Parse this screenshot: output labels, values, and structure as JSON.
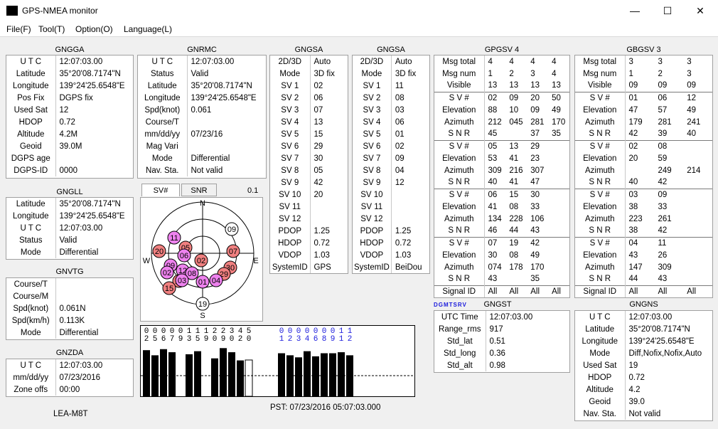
{
  "window": {
    "title": "GPS-NMEA monitor",
    "minimize": "—",
    "maximize": "☐",
    "close": "✕"
  },
  "menu": [
    "File(F)",
    "Tool(T)",
    "Option(O)",
    "Language(L)"
  ],
  "gngga": {
    "title": "GNGGA",
    "rows": [
      [
        "U T C",
        "12:07:03.00"
      ],
      [
        "Latitude",
        " 35°20'08.7174\"N"
      ],
      [
        "Longitude",
        "139°24'25.6548\"E"
      ],
      [
        "Pos Fix",
        "DGPS fix"
      ],
      [
        "Used Sat",
        "12"
      ],
      [
        "HDOP",
        "0.72"
      ],
      [
        "Altitude",
        "4.2M"
      ],
      [
        "Geoid",
        "39.0M"
      ],
      [
        "DGPS age",
        ""
      ],
      [
        "DGPS-ID",
        "0000"
      ]
    ]
  },
  "gnrmc": {
    "title": "GNRMC",
    "rows": [
      [
        "U T C",
        "12:07:03.00"
      ],
      [
        "Status",
        "Valid"
      ],
      [
        "Latitude",
        " 35°20'08.7174\"N"
      ],
      [
        "Longitude",
        "139°24'25.6548\"E"
      ],
      [
        "Spd(knot)",
        "0.061"
      ],
      [
        "Course/T",
        ""
      ],
      [
        "mm/dd/yy",
        "07/23/16"
      ],
      [
        "Mag Vari",
        ""
      ],
      [
        "Mode",
        "Differential"
      ],
      [
        "Nav. Sta.",
        "Not valid"
      ]
    ]
  },
  "gngll": {
    "title": "GNGLL",
    "rows": [
      [
        "Latitude",
        " 35°20'08.7174\"N"
      ],
      [
        "Longitude",
        "139°24'25.6548\"E"
      ],
      [
        "U T C",
        "12:07:03.00"
      ],
      [
        "Status",
        "Valid"
      ],
      [
        "Mode",
        "Differential"
      ]
    ]
  },
  "gnvtg": {
    "title": "GNVTG",
    "rows": [
      [
        "Course/T",
        ""
      ],
      [
        "Course/M",
        ""
      ],
      [
        "Spd(knot)",
        "0.061N"
      ],
      [
        "Spd(km/h)",
        "0.113K"
      ],
      [
        "Mode",
        "Differential"
      ]
    ]
  },
  "gnzda": {
    "title": "GNZDA",
    "rows": [
      [
        "U T C",
        "12:07:03.00"
      ],
      [
        "mm/dd/yy",
        "07/23/2016"
      ],
      [
        "Zone offs",
        "00:00"
      ]
    ]
  },
  "gnsa1": {
    "title": "GNGSA",
    "rows": [
      [
        "2D/3D",
        "Auto"
      ],
      [
        "Mode",
        "3D fix"
      ],
      [
        "SV 1",
        "02"
      ],
      [
        "SV 2",
        "06"
      ],
      [
        "SV 3",
        "07"
      ],
      [
        "SV 4",
        "13"
      ],
      [
        "SV 5",
        "15"
      ],
      [
        "SV 6",
        "29"
      ],
      [
        "SV 7",
        "30"
      ],
      [
        "SV 8",
        "05"
      ],
      [
        "SV 9",
        "42"
      ],
      [
        "SV 10",
        "20"
      ],
      [
        "SV 11",
        ""
      ],
      [
        "SV 12",
        ""
      ],
      [
        "PDOP",
        "1.25"
      ],
      [
        "HDOP",
        "0.72"
      ],
      [
        "VDOP",
        "1.03"
      ],
      [
        "SystemID",
        "GPS"
      ]
    ]
  },
  "gnsa2": {
    "title": "GNGSA",
    "rows": [
      [
        "2D/3D",
        "Auto"
      ],
      [
        "Mode",
        "3D fix"
      ],
      [
        "SV 1",
        "11"
      ],
      [
        "SV 2",
        "08"
      ],
      [
        "SV 3",
        "03"
      ],
      [
        "SV 4",
        "06"
      ],
      [
        "SV 5",
        "01"
      ],
      [
        "SV 6",
        "02"
      ],
      [
        "SV 7",
        "09"
      ],
      [
        "SV 8",
        "04"
      ],
      [
        "SV 9",
        "12"
      ],
      [
        "SV 10",
        ""
      ],
      [
        "SV 11",
        ""
      ],
      [
        "SV 12",
        ""
      ],
      [
        "PDOP",
        "1.25"
      ],
      [
        "HDOP",
        "0.72"
      ],
      [
        "VDOP",
        "1.03"
      ],
      [
        "SystemID",
        "BeiDou"
      ]
    ]
  },
  "gpgsv": {
    "title": "GPGSV 4",
    "rows": [
      [
        "Msg total",
        "4",
        "4",
        "4",
        "4"
      ],
      [
        "Msg num",
        "1",
        "2",
        "3",
        "4"
      ],
      [
        "Visible",
        "13",
        "13",
        "13",
        "13"
      ],
      [
        "S V #",
        "02",
        "09",
        "20",
        "50"
      ],
      [
        "Elevation",
        "88",
        "10",
        "09",
        "49"
      ],
      [
        "Azimuth",
        "212",
        "045",
        "281",
        "170"
      ],
      [
        "S N R",
        "45",
        "",
        "37",
        "35"
      ],
      [
        "S V #",
        "05",
        "13",
        "29",
        ""
      ],
      [
        "Elevation",
        "53",
        "41",
        "23",
        ""
      ],
      [
        "Azimuth",
        "309",
        "216",
        "307",
        ""
      ],
      [
        "S N R",
        "40",
        "41",
        "47",
        ""
      ],
      [
        "S V #",
        "06",
        "15",
        "30",
        ""
      ],
      [
        "Elevation",
        "41",
        "08",
        "33",
        ""
      ],
      [
        "Azimuth",
        "134",
        "228",
        "106",
        ""
      ],
      [
        "S N R",
        "46",
        "44",
        "43",
        ""
      ],
      [
        "S V #",
        "07",
        "19",
        "42",
        ""
      ],
      [
        "Elevation",
        "30",
        "08",
        "49",
        ""
      ],
      [
        "Azimuth",
        "074",
        "178",
        "170",
        ""
      ],
      [
        "S N R",
        "43",
        "",
        "35",
        ""
      ],
      [
        "Signal ID",
        "All",
        "All",
        "All",
        "All"
      ]
    ]
  },
  "gbgsv": {
    "title": "GBGSV 3",
    "rows": [
      [
        "Msg total",
        "3",
        "3",
        "3"
      ],
      [
        "Msg num",
        "1",
        "2",
        "3"
      ],
      [
        "Visible",
        "09",
        "09",
        "09"
      ],
      [
        "S V #",
        "01",
        "06",
        "12"
      ],
      [
        "Elevation",
        "47",
        "57",
        "49"
      ],
      [
        "Azimuth",
        "179",
        "281",
        "241"
      ],
      [
        "S N R",
        "42",
        "39",
        "40"
      ],
      [
        "S V #",
        "02",
        "08",
        ""
      ],
      [
        "Elevation",
        "20",
        "59",
        ""
      ],
      [
        "Azimuth",
        "",
        "249",
        "214"
      ],
      [
        "S N R",
        "40",
        "42",
        ""
      ],
      [
        "S V #",
        "03",
        "09",
        ""
      ],
      [
        "Elevation",
        "38",
        "33",
        ""
      ],
      [
        "Azimuth",
        "223",
        "261",
        ""
      ],
      [
        "S N R",
        "38",
        "42",
        ""
      ],
      [
        "S V #",
        "04",
        "11",
        ""
      ],
      [
        "Elevation",
        "43",
        "26",
        ""
      ],
      [
        "Azimuth",
        "147",
        "309",
        ""
      ],
      [
        "S N R",
        "44",
        "43",
        ""
      ],
      [
        "Signal ID",
        "All",
        "All",
        "All"
      ]
    ]
  },
  "gngst": {
    "title": "GNGST",
    "flags": "DGMTSRV",
    "rows": [
      [
        "UTC Time",
        "12:07:03.00"
      ],
      [
        "Range_rms",
        "917"
      ],
      [
        "Std_lat",
        "0.51"
      ],
      [
        "Std_long",
        "0.36"
      ],
      [
        "Std_alt",
        "0.98"
      ]
    ]
  },
  "gngns": {
    "title": "GNGNS",
    "rows": [
      [
        "U T C",
        "12:07:03.00"
      ],
      [
        "Latitude",
        " 35°20'08.7174\"N"
      ],
      [
        "Longitude",
        "139°24'25.6548\"E"
      ],
      [
        "Mode",
        "Diff,Nofix,Nofix,Auto"
      ],
      [
        "Used Sat",
        "19"
      ],
      [
        "HDOP",
        "0.72"
      ],
      [
        "Altitude",
        "4.2"
      ],
      [
        "Geoid",
        "39.0"
      ],
      [
        "Nav. Sta.",
        "Not valid"
      ]
    ]
  },
  "sky": {
    "tab_sv": "SV#",
    "tab_snr": "SNR",
    "version": "0.1",
    "n": "N",
    "s": "S",
    "e": "E",
    "w": "W",
    "sats": [
      {
        "id": "11",
        "cls": "bd"
      },
      {
        "id": "09",
        "cls": "none"
      },
      {
        "id": "05",
        "cls": "gps"
      },
      {
        "id": "20",
        "cls": "gps"
      },
      {
        "id": "06",
        "cls": "bd"
      },
      {
        "id": "02",
        "cls": "gps"
      },
      {
        "id": "07",
        "cls": "gps"
      },
      {
        "id": "09",
        "cls": "bd"
      },
      {
        "id": "02",
        "cls": "bd"
      },
      {
        "id": "12",
        "cls": "bd"
      },
      {
        "id": "08",
        "cls": "bd"
      },
      {
        "id": "13",
        "cls": "gps"
      },
      {
        "id": "03",
        "cls": "bd"
      },
      {
        "id": "30",
        "cls": "gps"
      },
      {
        "id": "29",
        "cls": "gps"
      },
      {
        "id": "01",
        "cls": "bd"
      },
      {
        "id": "04",
        "cls": "bd"
      },
      {
        "id": "15",
        "cls": "gps"
      },
      {
        "id": "19",
        "cls": "none"
      }
    ]
  },
  "snr_chart": {
    "gps_labels": [
      "02",
      "05",
      "06",
      "07",
      "09",
      "13",
      "15",
      "19",
      "20",
      "29",
      "30",
      "42",
      "50"
    ],
    "gps_values": [
      45,
      40,
      46,
      43,
      0,
      41,
      44,
      0,
      37,
      47,
      43,
      35,
      0
    ],
    "bd_labels": [
      "01",
      "02",
      "03",
      "04",
      "06",
      "08",
      "09",
      "11",
      "12"
    ],
    "bd_values": [
      42,
      40,
      38,
      44,
      39,
      42,
      42,
      43,
      40
    ]
  },
  "status": {
    "pst": "PST: 07/23/2016 05:07:03.000",
    "receiver": "LEA-M8T"
  },
  "colors": {
    "gps": "#f08080",
    "beidou": "#ee82ee",
    "chart_bar": "#000000",
    "gps_label": "#000000",
    "bd_label": "#1a1adc"
  }
}
